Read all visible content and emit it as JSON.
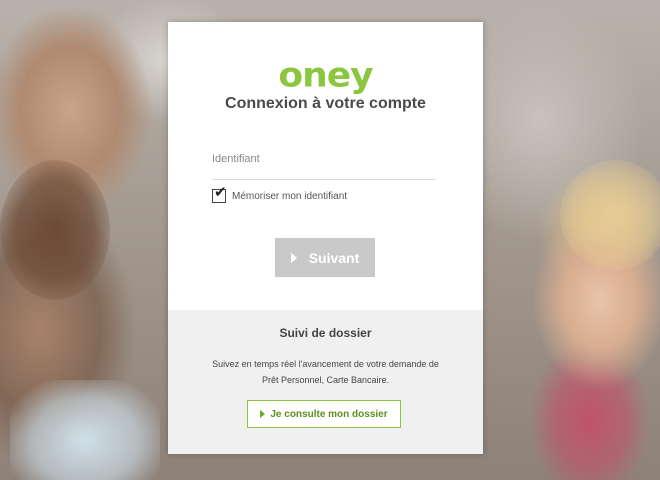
{
  "brand": {
    "logo_text": "oney",
    "accent_color": "#8cc63f"
  },
  "login": {
    "title": "Connexion à votre compte",
    "identifier_placeholder": "Identifiant",
    "identifier_value": "",
    "remember_label": "Mémoriser mon identifiant",
    "remember_checked": true,
    "next_button_label": "Suivant",
    "next_button_icon": "play-icon"
  },
  "tracking": {
    "title": "Suivi de dossier",
    "description_line1": "Suivez en temps réel l'avancement de votre demande de",
    "description_line2": "Prêt Personnel, Carte Bancaire.",
    "consult_button_label": "Je consulte mon dossier",
    "consult_button_icon": "play-icon"
  },
  "background": {
    "image": "family-photo"
  }
}
